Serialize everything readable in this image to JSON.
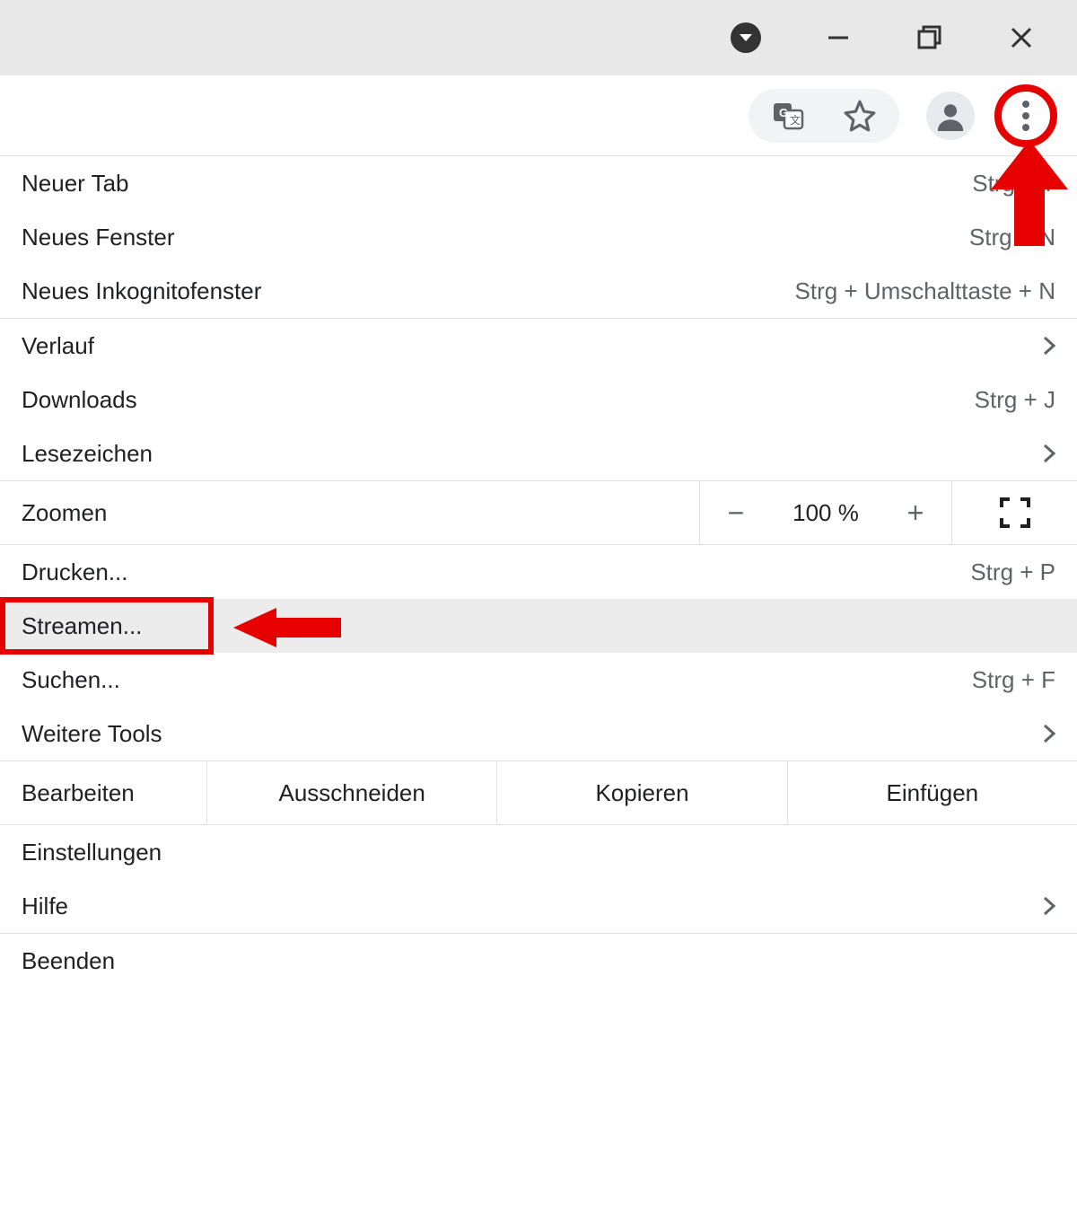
{
  "menu": {
    "new_tab": {
      "label": "Neuer Tab",
      "shortcut": "Strg + T"
    },
    "new_window": {
      "label": "Neues Fenster",
      "shortcut": "Strg + N"
    },
    "new_incognito": {
      "label": "Neues Inkognitofenster",
      "shortcut": "Strg + Umschalttaste + N"
    },
    "history": {
      "label": "Verlauf"
    },
    "downloads": {
      "label": "Downloads",
      "shortcut": "Strg + J"
    },
    "bookmarks": {
      "label": "Lesezeichen"
    },
    "zoom": {
      "label": "Zoomen",
      "minus": "−",
      "value": "100 %",
      "plus": "+"
    },
    "print": {
      "label": "Drucken...",
      "shortcut": "Strg + P"
    },
    "cast": {
      "label": "Streamen..."
    },
    "find": {
      "label": "Suchen...",
      "shortcut": "Strg + F"
    },
    "more_tools": {
      "label": "Weitere Tools"
    },
    "edit": {
      "label": "Bearbeiten",
      "cut": "Ausschneiden",
      "copy": "Kopieren",
      "paste": "Einfügen"
    },
    "settings": {
      "label": "Einstellungen"
    },
    "help": {
      "label": "Hilfe"
    },
    "exit": {
      "label": "Beenden"
    }
  }
}
